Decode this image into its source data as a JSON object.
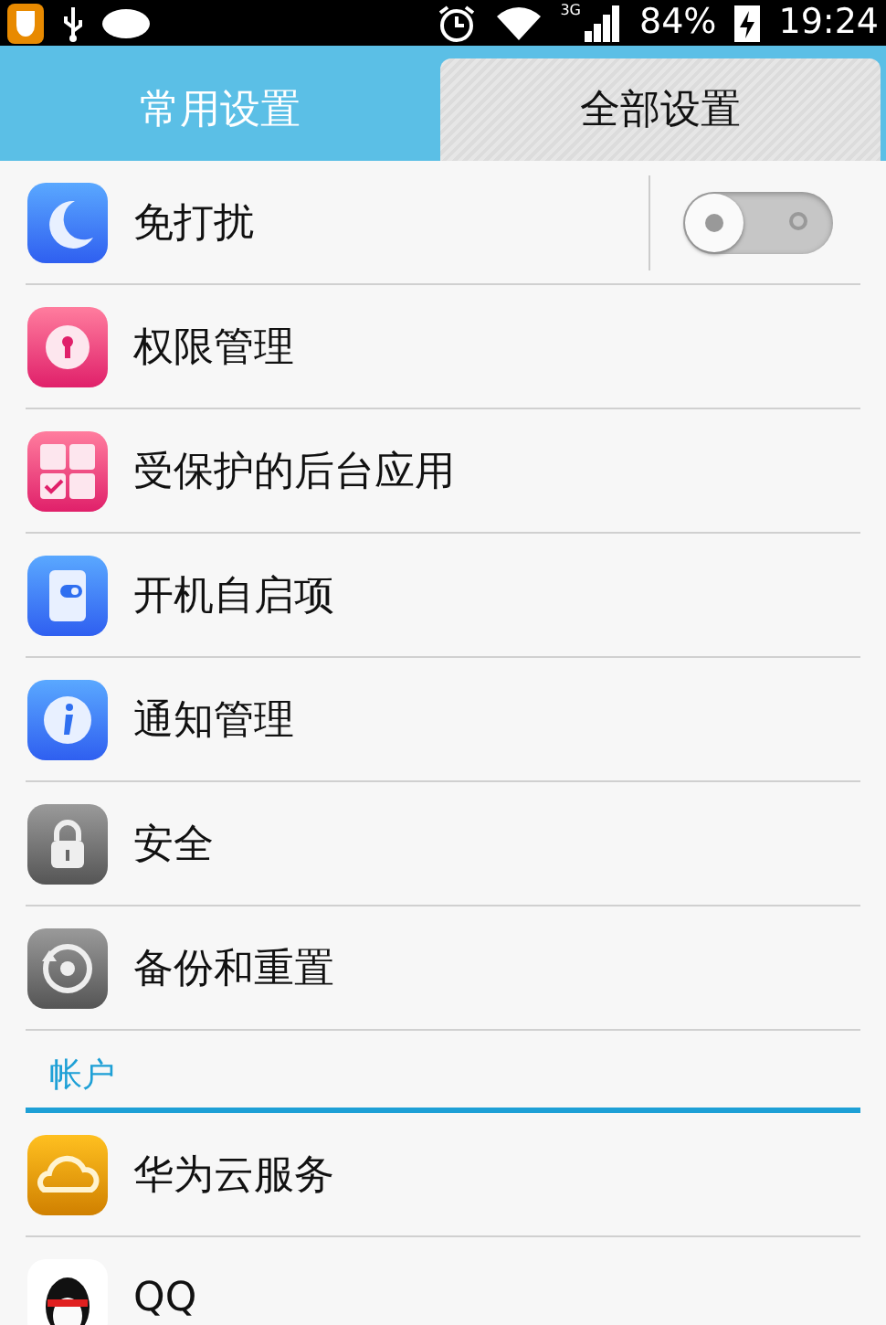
{
  "status_bar": {
    "network": "3G",
    "battery": "84%",
    "time": "19:24"
  },
  "tabs": [
    {
      "label": "常用设置",
      "selected": true
    },
    {
      "label": "全部设置",
      "selected": false
    }
  ],
  "sections": [
    {
      "rows": [
        {
          "label": "免打扰",
          "kind": "switch",
          "on": false
        },
        {
          "label": "权限管理",
          "kind": "link"
        },
        {
          "label": "受保护的后台应用",
          "kind": "link"
        },
        {
          "label": "开机自启项",
          "kind": "link"
        },
        {
          "label": "通知管理",
          "kind": "link"
        },
        {
          "label": "安全",
          "kind": "link"
        },
        {
          "label": "备份和重置",
          "kind": "link"
        }
      ]
    },
    {
      "header": "帐户",
      "rows": [
        {
          "label": "华为云服务",
          "kind": "link"
        },
        {
          "label": "QQ",
          "kind": "link"
        }
      ]
    }
  ]
}
